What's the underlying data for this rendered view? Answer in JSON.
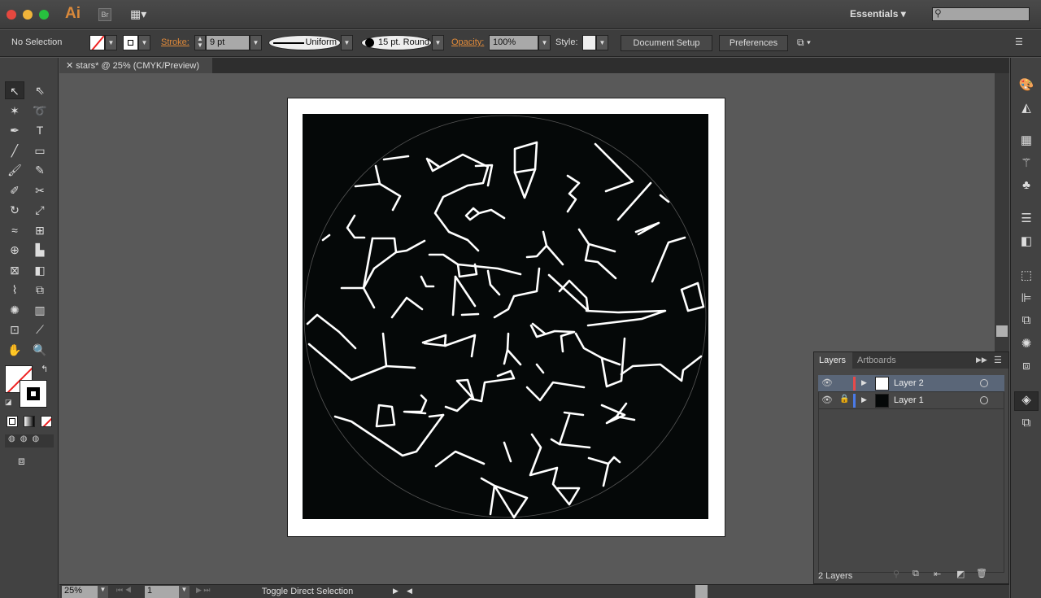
{
  "app": {
    "logo": "Ai",
    "bridge": "Br",
    "workspace": "Essentials",
    "search_placeholder": ""
  },
  "control": {
    "selection": "No Selection",
    "stroke_label": "Stroke:",
    "stroke_weight": "9 pt",
    "profile": "Uniform",
    "brush": "15 pt. Round",
    "opacity_label": "Opacity:",
    "opacity": "100%",
    "style_label": "Style:",
    "document_setup": "Document Setup",
    "preferences": "Preferences"
  },
  "document": {
    "tab": "stars* @ 25% (CMYK/Preview)"
  },
  "status": {
    "zoom": "25%",
    "artboard": "1",
    "tool_hint": "Toggle Direct Selection"
  },
  "layers_panel": {
    "tabs": [
      "Layers",
      "Artboards"
    ],
    "layers": [
      {
        "name": "Layer 2",
        "color": "#e84a4a",
        "locked": false,
        "selected": true
      },
      {
        "name": "Layer 1",
        "color": "#4a7ae8",
        "locked": true,
        "selected": false
      }
    ],
    "count": "2 Layers"
  },
  "colors": {
    "accent": "#e08a3a",
    "artwork_bg": "#050808",
    "selection_row": "#5a6678"
  }
}
